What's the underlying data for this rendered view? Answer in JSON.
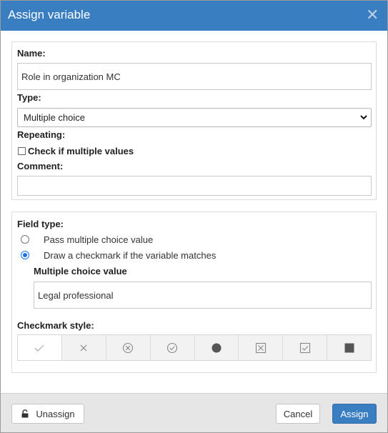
{
  "dialog": {
    "title": "Assign variable",
    "close_icon": "close-icon"
  },
  "variable": {
    "name_label": "Name:",
    "name_value": "Role in organization MC",
    "type_label": "Type:",
    "type_value": "Multiple choice",
    "repeating_label": "Repeating:",
    "repeating_checkbox_label": "Check if multiple values",
    "repeating_checked": false,
    "comment_label": "Comment:",
    "comment_value": ""
  },
  "field_type": {
    "label": "Field type:",
    "options": [
      {
        "label": "Pass multiple choice value",
        "selected": false
      },
      {
        "label": "Draw a checkmark if the variable matches",
        "selected": true
      }
    ],
    "mc_value_label": "Multiple choice value",
    "mc_value": "Legal professional",
    "checkmark_style_label": "Checkmark style:",
    "checkmark_styles": [
      "check-icon",
      "cross-icon",
      "circled-cross-icon",
      "circled-check-icon",
      "filled-circle-icon",
      "boxed-cross-icon",
      "boxed-check-icon",
      "filled-square-icon"
    ],
    "selected_style": "check-icon"
  },
  "footer": {
    "unassign_label": "Unassign",
    "cancel_label": "Cancel",
    "assign_label": "Assign"
  },
  "colors": {
    "titlebar": "#3a7ec2",
    "primary_button": "#3a7ec2",
    "radio_selected": "#1a73e8"
  }
}
